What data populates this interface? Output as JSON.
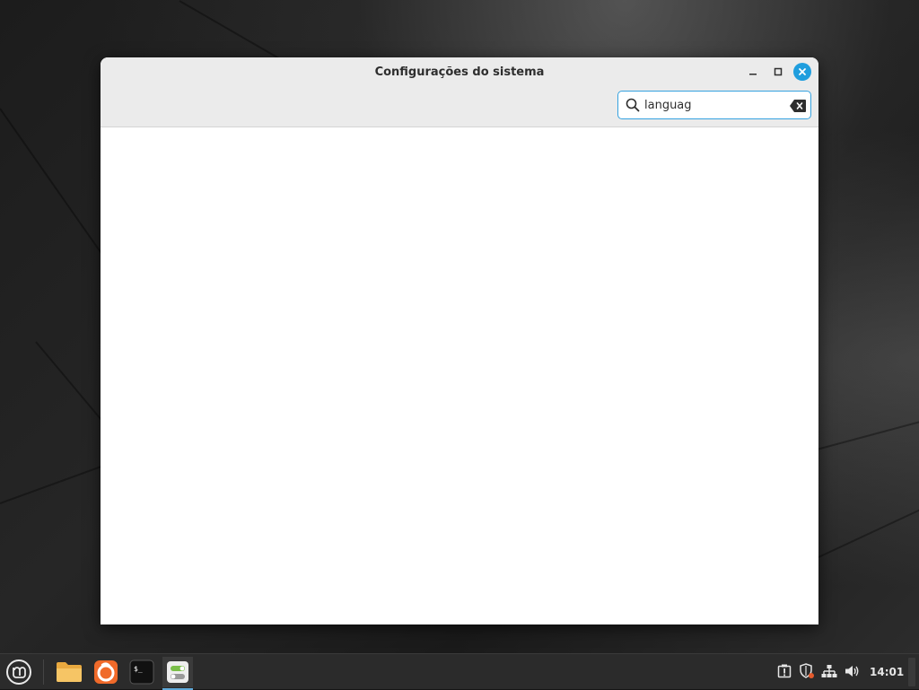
{
  "window": {
    "title": "Configurações do sistema",
    "controls": [
      "minimize-icon",
      "maximize-icon",
      "close-icon"
    ]
  },
  "search": {
    "value": "languag",
    "icon": "search-icon",
    "clear_icon": "clear-text-icon"
  },
  "content": {
    "results": []
  },
  "taskbar": {
    "apps": [
      {
        "name": "menu",
        "icon": "linux-mint-menu-icon"
      },
      {
        "name": "files",
        "icon": "folder-icon"
      },
      {
        "name": "firefox",
        "icon": "firefox-icon"
      },
      {
        "name": "terminal",
        "icon": "terminal-icon",
        "glyph": "$_"
      },
      {
        "name": "system-settings",
        "icon": "settings-toggles-icon",
        "active": true
      }
    ],
    "tray": [
      "update-manager-icon",
      "shield-icon",
      "network-icon",
      "volume-icon"
    ],
    "clock": "14:01"
  },
  "colors": {
    "accent": "#1f9ede",
    "headerbar": "#ebebeb",
    "taskbar": "#2b2b2b"
  }
}
